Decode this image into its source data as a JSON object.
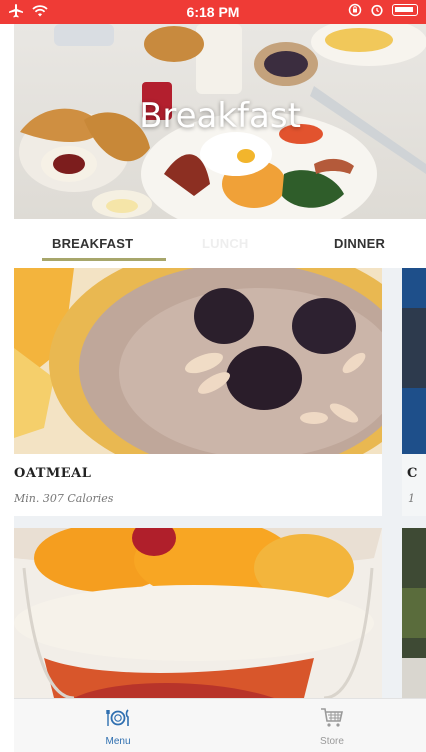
{
  "status_bar": {
    "time": "6:18 PM",
    "airplane_icon": "airplane-icon",
    "wifi_icon": "wifi-icon"
  },
  "hero": {
    "title": "Breakfast"
  },
  "tabs": [
    {
      "label": "BREAKFAST",
      "selected": true
    },
    {
      "label": "LUNCH",
      "selected": false
    },
    {
      "label": "DINNER",
      "selected": false
    }
  ],
  "cards": [
    {
      "name": "OATMEAL",
      "calories": "Min. 307 Calories"
    },
    {
      "name": "C",
      "calories": "1"
    }
  ],
  "bottom_nav": {
    "menu_label": "Menu",
    "store_label": "Store"
  },
  "colors": {
    "status_bar": "#ef3b36",
    "tab_underline": "#a7a66b",
    "active_nav": "#2f6fb0",
    "inactive_nav": "#9a9a9a"
  }
}
